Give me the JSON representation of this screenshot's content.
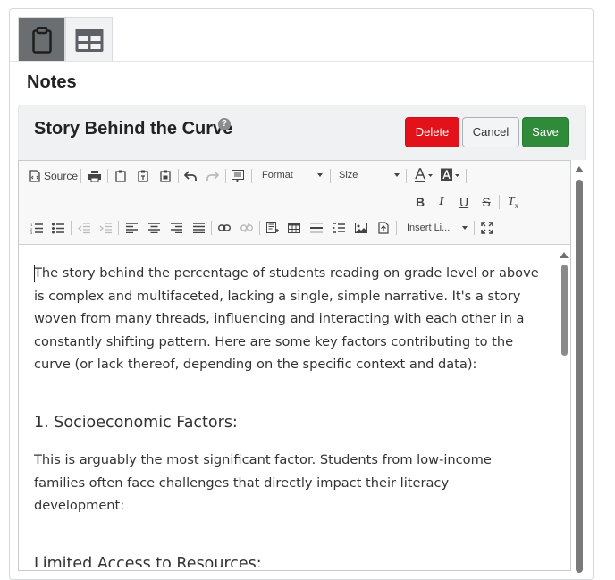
{
  "section_title": "Notes",
  "story": {
    "title": "Story Behind the Curve",
    "help": "?"
  },
  "buttons": {
    "delete": "Delete",
    "cancel": "Cancel",
    "save": "Save"
  },
  "toolbar": {
    "source": "Source",
    "format": "Format",
    "size": "Size",
    "insert": "Insert Li...",
    "bold": "B",
    "italic": "I",
    "underline": "U",
    "strike": "S",
    "clear": "T"
  },
  "content": {
    "paragraph1": "The story behind the percentage of students reading on grade level or above is complex and multifaceted, lacking a single, simple narrative. It's a story woven from many threads, influencing and interacting with each other in a constantly shifting pattern. Here are some key factors contributing to the curve (or lack thereof, depending on the specific context and data):",
    "heading1": "1. Socioeconomic Factors:",
    "paragraph2": "This is arguably the most significant factor. Students from low-income families often face challenges that directly impact their literacy development:",
    "heading2": "Limited Access to Resources:"
  },
  "colors": {
    "delete": "#e3121a",
    "save": "#2f8a3a",
    "active_tab": "#6b6e71"
  }
}
